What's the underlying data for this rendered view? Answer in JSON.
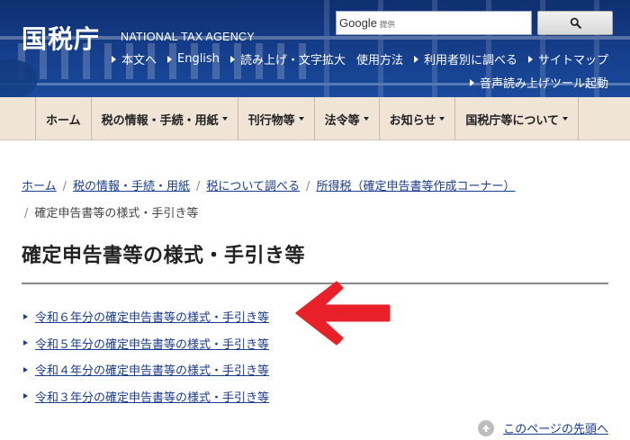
{
  "header": {
    "logo_ja": "国税庁",
    "logo_en": "NATIONAL TAX AGENCY",
    "search": {
      "brand": "Google",
      "brand_sub": "提供",
      "placeholder": ""
    },
    "utility_links": [
      "本文へ",
      "English",
      "読み上げ・文字拡大",
      "使用方法",
      "利用者別に調べる",
      "サイトマップ"
    ],
    "voice_tool": "音声読み上げツール起動"
  },
  "nav": [
    {
      "label": "ホーム",
      "dropdown": false
    },
    {
      "label": "税の情報・手続・用紙",
      "dropdown": true
    },
    {
      "label": "刊行物等",
      "dropdown": true
    },
    {
      "label": "法令等",
      "dropdown": true
    },
    {
      "label": "お知らせ",
      "dropdown": true
    },
    {
      "label": "国税庁等について",
      "dropdown": true
    }
  ],
  "breadcrumb": {
    "items": [
      "ホーム",
      "税の情報・手続・用紙",
      "税について調べる",
      "所得税（確定申告書等作成コーナー）"
    ],
    "current": "確定申告書等の様式・手引き等"
  },
  "page": {
    "title": "確定申告書等の様式・手引き等",
    "links": [
      "令和６年分の確定申告書等の様式・手引き等",
      "令和５年分の確定申告書等の様式・手引き等",
      "令和４年分の確定申告書等の様式・手引き等",
      "令和３年分の確定申告書等の様式・手引き等"
    ],
    "back_to_top": "このページの先頭へ"
  },
  "colors": {
    "header_bg": "#16408e",
    "nav_bg": "#efe4d6",
    "link": "#1a3d8f",
    "annotation_arrow": "#e8202a"
  }
}
